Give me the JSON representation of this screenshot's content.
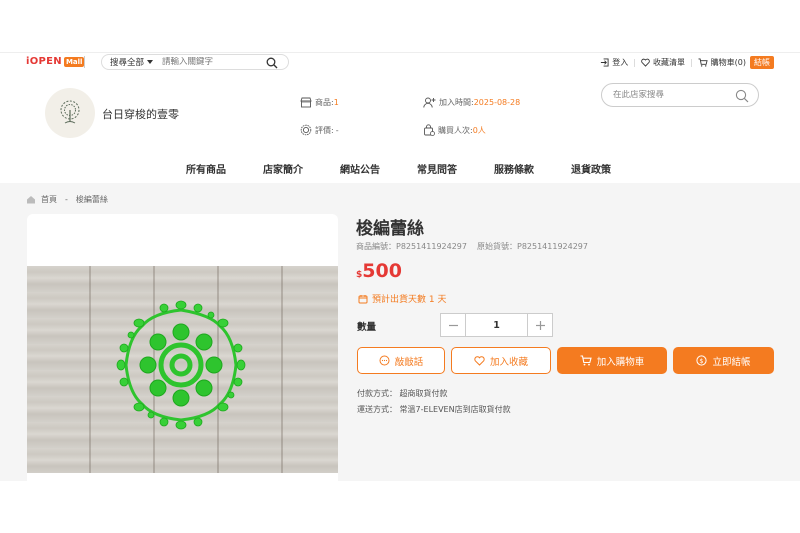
{
  "topbar": {
    "logo_text": "iOPEN",
    "logo_badge": "Mall",
    "search_scope": "搜尋全部",
    "search_placeholder": "請輸入關鍵字",
    "login": "登入",
    "wishlist": "收藏清單",
    "cart": "購物車",
    "cart_count": "(0)",
    "checkout": "結帳"
  },
  "store": {
    "name": "台日穿梭的壹零",
    "products_label": "商品:",
    "products_value": "1",
    "joined_label": "加入時間:",
    "joined_value": "2025-08-28",
    "rating_label": "評價:",
    "rating_value": "-",
    "buyers_label": "購買人次:",
    "buyers_value": "0人",
    "search_placeholder": "在此店家搜尋"
  },
  "nav": {
    "items": [
      "所有商品",
      "店家簡介",
      "網站公告",
      "常見問答",
      "服務條款",
      "退貨政策"
    ]
  },
  "breadcrumb": {
    "home": "首頁",
    "separator": "-",
    "current": "梭編蕾絲"
  },
  "product": {
    "title": "梭編蕾絲",
    "code": "商品編號：P8251411924297",
    "original_code": "原始貨號：P8251411924297",
    "currency": "$",
    "price": "500",
    "shipping": "預計出貨天數 1 天",
    "qty_label": "數量",
    "qty_value": "1",
    "chat_button": "敲敲話",
    "favorite_button": "加入收藏",
    "cart_button": "加入購物車",
    "buy_button": "立即結帳",
    "payment": "付款方式：  超商取貨付款",
    "delivery": "運送方式：  常溫7-ELEVEN店到店取貨付款"
  },
  "colors": {
    "accent": "#f47b20",
    "price": "#e53935",
    "lace": "#2ec42e",
    "background": "#f5f5f5"
  }
}
